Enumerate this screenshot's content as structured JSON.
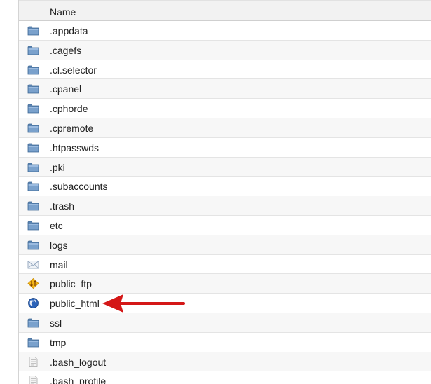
{
  "table": {
    "column_name": "Name",
    "rows": [
      {
        "name": ".appdata",
        "icon": "folder-icon"
      },
      {
        "name": ".cagefs",
        "icon": "folder-icon"
      },
      {
        "name": ".cl.selector",
        "icon": "folder-icon"
      },
      {
        "name": ".cpanel",
        "icon": "folder-icon"
      },
      {
        "name": ".cphorde",
        "icon": "folder-icon"
      },
      {
        "name": ".cpremote",
        "icon": "folder-icon"
      },
      {
        "name": ".htpasswds",
        "icon": "folder-icon"
      },
      {
        "name": ".pki",
        "icon": "folder-icon"
      },
      {
        "name": ".subaccounts",
        "icon": "folder-icon"
      },
      {
        "name": ".trash",
        "icon": "folder-icon"
      },
      {
        "name": "etc",
        "icon": "folder-icon"
      },
      {
        "name": "logs",
        "icon": "folder-icon"
      },
      {
        "name": "mail",
        "icon": "mail-folder-icon"
      },
      {
        "name": "public_ftp",
        "icon": "ftp-folder-icon"
      },
      {
        "name": "public_html",
        "icon": "globe-icon"
      },
      {
        "name": "ssl",
        "icon": "folder-icon"
      },
      {
        "name": "tmp",
        "icon": "folder-icon"
      },
      {
        "name": ".bash_logout",
        "icon": "file-icon"
      },
      {
        "name": ".bash_profile",
        "icon": "file-icon"
      }
    ]
  },
  "colors": {
    "folder": "#5b84b1",
    "arrow": "#d41717",
    "header_bg": "#f2f2f2",
    "row_alt_bg": "#f7f7f7"
  },
  "annotation": {
    "arrow_icon": "red-arrow-icon",
    "points_to": "public_html"
  }
}
